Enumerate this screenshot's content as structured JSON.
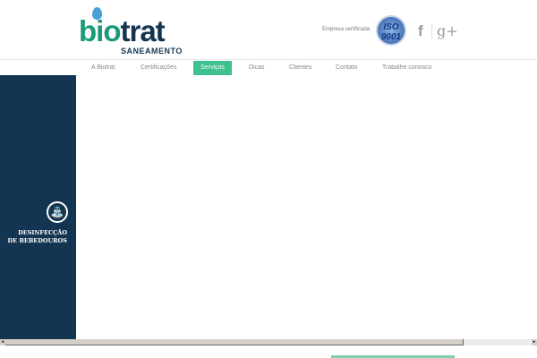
{
  "header": {
    "logo_text_a": "bio",
    "logo_text_b": "trat",
    "logo_sub": "SANEAMENTO",
    "cert_label": "Empresa certificada",
    "iso_badge": "ISO 9001",
    "facebook": "f",
    "googleplus": "g+"
  },
  "nav": {
    "items": [
      {
        "label": "A Biotrat"
      },
      {
        "label": "Certificações"
      },
      {
        "label": "Serviços",
        "active": true
      },
      {
        "label": "Dicas"
      },
      {
        "label": "Clientes"
      },
      {
        "label": "Contato"
      },
      {
        "label": "Trabalhe conosco"
      }
    ]
  },
  "sidebar": {
    "line1": "DESINFECÇÃO",
    "line2": "DE BEBEDOUROS"
  },
  "colors": {
    "accent": "#3fc08f",
    "navy": "#143552"
  }
}
